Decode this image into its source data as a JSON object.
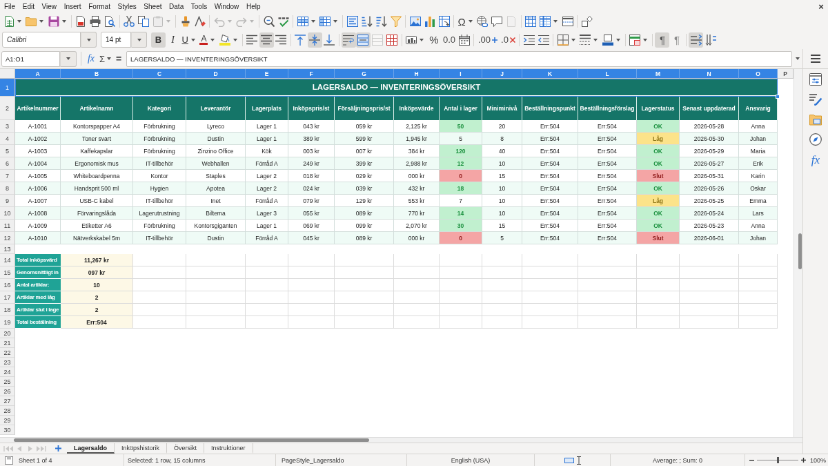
{
  "menu_bar": {
    "items": [
      "File",
      "Edit",
      "View",
      "Insert",
      "Format",
      "Styles",
      "Sheet",
      "Data",
      "Tools",
      "Window",
      "Help"
    ],
    "close": "×"
  },
  "standard_toolbar": {
    "buttons": [
      {
        "disabled": false
      },
      {
        "disabled": false
      },
      {
        "disabled": false
      },
      {
        "disabled": false
      },
      {
        "disabled": false
      },
      {
        "disabled": false
      },
      {
        "disabled": false
      },
      {
        "disabled": false
      },
      {
        "disabled": true
      },
      {
        "disabled": false
      },
      {
        "disabled": false
      },
      {
        "disabled": true
      },
      {
        "disabled": true
      },
      {
        "disabled": false
      },
      {
        "disabled": false
      },
      {
        "disabled": false
      },
      {
        "disabled": false
      },
      {
        "disabled": false
      },
      {
        "disabled": false
      },
      {
        "disabled": false
      },
      {
        "disabled": false
      },
      {
        "disabled": false
      },
      {
        "disabled": false
      },
      {
        "disabled": false
      },
      {
        "label": "Ω",
        "disabled": false
      },
      {
        "disabled": false
      },
      {
        "disabled": false
      },
      {
        "disabled": true
      },
      {
        "disabled": false
      },
      {
        "disabled": false
      },
      {
        "disabled": false
      },
      {
        "disabled": false
      }
    ]
  },
  "formatting_toolbar": {
    "font_name": "Calibri",
    "font_size": "14 pt",
    "buttons": [
      {
        "label": "B",
        "on": true,
        "disabled": false
      },
      {
        "label": "I",
        "on": false,
        "disabled": false
      },
      {
        "label": "U",
        "on": false,
        "disabled": false
      },
      {
        "label": "A",
        "on": false,
        "disabled": false
      },
      {
        "on": false,
        "disabled": false
      },
      {
        "on": false,
        "disabled": false
      },
      {
        "on": true,
        "disabled": false
      },
      {
        "on": false,
        "disabled": false
      },
      {
        "on": false,
        "disabled": false
      },
      {
        "on": true,
        "disabled": false
      },
      {
        "on": false,
        "disabled": false
      },
      {
        "on": true,
        "disabled": false
      },
      {
        "on": true,
        "disabled": false
      },
      {
        "on": false,
        "disabled": true
      },
      {
        "on": false,
        "disabled": false
      },
      {
        "on": false,
        "disabled": false
      },
      {
        "label": "%",
        "on": false,
        "disabled": false
      },
      {
        "label": "0.0",
        "on": false,
        "disabled": false
      },
      {
        "on": false,
        "disabled": false
      },
      {
        "label": ".00",
        "on": false,
        "disabled": false
      },
      {
        "label": ".0",
        "on": false,
        "disabled": false
      },
      {
        "on": false,
        "disabled": false
      },
      {
        "on": false,
        "disabled": false
      },
      {
        "on": false,
        "disabled": false
      },
      {
        "on": false,
        "disabled": false
      },
      {
        "on": false,
        "disabled": false
      },
      {
        "on": false,
        "disabled": false
      },
      {
        "label": "¶",
        "on": true,
        "disabled": false
      },
      {
        "label": "¶",
        "on": false,
        "disabled": false
      },
      {
        "on": true,
        "disabled": false
      },
      {
        "on": false,
        "disabled": false
      }
    ]
  },
  "formula_bar": {
    "name_box": "A1:O1",
    "function_wizard": "fx",
    "sum": "Σ",
    "equals": "=",
    "content": "LAGERSALDO — INVENTERINGSÖVERSIKT"
  },
  "sheet": {
    "columns": [
      {
        "label": "A",
        "selected": true
      },
      {
        "label": "B",
        "selected": true
      },
      {
        "label": "C",
        "selected": true
      },
      {
        "label": "D",
        "selected": true
      },
      {
        "label": "E",
        "selected": true
      },
      {
        "label": "F",
        "selected": true
      },
      {
        "label": "G",
        "selected": true
      },
      {
        "label": "H",
        "selected": true
      },
      {
        "label": "I",
        "selected": true
      },
      {
        "label": "J",
        "selected": true
      },
      {
        "label": "K",
        "selected": true
      },
      {
        "label": "L",
        "selected": true
      },
      {
        "label": "M",
        "selected": true
      },
      {
        "label": "N",
        "selected": true
      },
      {
        "label": "O",
        "selected": true
      },
      {
        "label": "P",
        "selected": false
      }
    ],
    "rows": [
      {
        "kind": "title",
        "number": "1",
        "selected": true,
        "text": "LAGERSALDO — INVENTERINGSÖVERSIKT"
      },
      {
        "kind": "header",
        "number": "2",
        "selected": false,
        "cells": [
          "Artikelnummer",
          "Artikelnamn",
          "Kategori",
          "Leverantör",
          "Lagerplats",
          "Inköpspris/st",
          "Försäljningspris/st",
          "Inköpsvärde",
          "Antal i lager",
          "Miniminivå",
          "Beställningspunkt",
          "Beställningsförslag",
          "Lagerstatus",
          "Senast uppdaterad",
          "Ansvarig"
        ]
      },
      {
        "kind": "data",
        "number": "3",
        "selected": false,
        "cells": [
          "A-1001",
          "Kontorspapper A4",
          "Förbrukning",
          "Lyreco",
          "Lager 1",
          "043 kr",
          "059 kr",
          "2,125 kr",
          {
            "text": "50",
            "color": "#c1f0cf"
          },
          "20",
          "Err:504",
          "Err:504",
          {
            "text": "OK",
            "color": "#c1f0cf"
          },
          "2026-05-28",
          "Anna"
        ]
      },
      {
        "kind": "data",
        "number": "4",
        "selected": false,
        "cells": [
          "A-1002",
          "Toner svart",
          "Förbrukning",
          "Dustin",
          "Lager 1",
          "389 kr",
          "599 kr",
          "1,945 kr",
          "5",
          "8",
          "Err:504",
          "Err:504",
          {
            "text": "Låg",
            "color": "#fce38a"
          },
          "2026-05-30",
          "Johan"
        ]
      },
      {
        "kind": "data",
        "number": "5",
        "selected": false,
        "cells": [
          "A-1003",
          "Kaffekapslar",
          "Förbrukning",
          "Zinzino Office",
          "Kök",
          "003 kr",
          "007 kr",
          "384 kr",
          {
            "text": "120",
            "color": "#c1f0cf"
          },
          "40",
          "Err:504",
          "Err:504",
          {
            "text": "OK",
            "color": "#c1f0cf"
          },
          "2026-05-29",
          "Maria"
        ]
      },
      {
        "kind": "data",
        "number": "6",
        "selected": false,
        "cells": [
          "A-1004",
          "Ergonomisk mus",
          "IT-tillbehör",
          "Webhallen",
          "Förråd A",
          "249 kr",
          "399 kr",
          "2,988 kr",
          {
            "text": "12",
            "color": "#c1f0cf"
          },
          "10",
          "Err:504",
          "Err:504",
          {
            "text": "OK",
            "color": "#c1f0cf"
          },
          "2026-05-27",
          "Erik"
        ]
      },
      {
        "kind": "data",
        "number": "7",
        "selected": false,
        "cells": [
          "A-1005",
          "Whiteboardpenna",
          "Kontor",
          "Staples",
          "Lager 2",
          "018 kr",
          "029 kr",
          "000 kr",
          {
            "text": "0",
            "color": "#f4a5a5"
          },
          "15",
          "Err:504",
          "Err:504",
          {
            "text": "Slut",
            "color": "#f4a5a5"
          },
          "2026-05-31",
          "Karin"
        ]
      },
      {
        "kind": "data",
        "number": "8",
        "selected": false,
        "cells": [
          "A-1006",
          "Handsprit 500 ml",
          "Hygien",
          "Apotea",
          "Lager 2",
          "024 kr",
          "039 kr",
          "432 kr",
          {
            "text": "18",
            "color": "#c1f0cf"
          },
          "10",
          "Err:504",
          "Err:504",
          {
            "text": "OK",
            "color": "#c1f0cf"
          },
          "2026-05-26",
          "Oskar"
        ]
      },
      {
        "kind": "data",
        "number": "9",
        "selected": false,
        "cells": [
          "A-1007",
          "USB-C kabel",
          "IT-tillbehör",
          "Inet",
          "Förråd A",
          "079 kr",
          "129 kr",
          "553 kr",
          "7",
          "10",
          "Err:504",
          "Err:504",
          {
            "text": "Låg",
            "color": "#fce38a"
          },
          "2026-05-25",
          "Emma"
        ]
      },
      {
        "kind": "data",
        "number": "10",
        "selected": false,
        "cells": [
          "A-1008",
          "Förvaringslåda",
          "Lagerutrustning",
          "Biltema",
          "Lager 3",
          "055 kr",
          "089 kr",
          "770 kr",
          {
            "text": "14",
            "color": "#c1f0cf"
          },
          "10",
          "Err:504",
          "Err:504",
          {
            "text": "OK",
            "color": "#c1f0cf"
          },
          "2026-05-24",
          "Lars"
        ]
      },
      {
        "kind": "data",
        "number": "11",
        "selected": false,
        "cells": [
          "A-1009",
          "Etiketter A6",
          "Förbrukning",
          "Kontorsgiganten",
          "Lager 1",
          "069 kr",
          "099 kr",
          "2,070 kr",
          {
            "text": "30",
            "color": "#c1f0cf"
          },
          "15",
          "Err:504",
          "Err:504",
          {
            "text": "OK",
            "color": "#c1f0cf"
          },
          "2026-05-23",
          "Anna"
        ]
      },
      {
        "kind": "data",
        "number": "12",
        "selected": false,
        "cells": [
          "A-1010",
          "Nätverkskabel 5m",
          "IT-tillbehör",
          "Dustin",
          "Förråd A",
          "045 kr",
          "089 kr",
          "000 kr",
          {
            "text": "0",
            "color": "#f4a5a5"
          },
          "5",
          "Err:504",
          "Err:504",
          {
            "text": "Slut",
            "color": "#f4a5a5"
          },
          "2026-06-01",
          "Johan"
        ]
      },
      {
        "kind": "blank",
        "number": "13",
        "selected": false
      },
      {
        "kind": "summary",
        "number": "14",
        "selected": false,
        "label": "Total inköpsvärd",
        "value": "11,267 kr"
      },
      {
        "kind": "summary",
        "number": "15",
        "selected": false,
        "label": "Genomsnittligt in",
        "value": "097 kr"
      },
      {
        "kind": "summary",
        "number": "16",
        "selected": false,
        "label": "Antal artiklar:",
        "value": "10"
      },
      {
        "kind": "summary",
        "number": "17",
        "selected": false,
        "label": "Artiklar med låg",
        "value": "2"
      },
      {
        "kind": "summary",
        "number": "18",
        "selected": false,
        "label": "Artiklar slut i lage",
        "value": "2"
      },
      {
        "kind": "summary",
        "number": "19",
        "selected": false,
        "label": "Total beställning",
        "value": "Err:504"
      },
      {
        "kind": "blank",
        "number": "20",
        "selected": false
      },
      {
        "kind": "blank",
        "number": "21",
        "selected": false
      },
      {
        "kind": "blank",
        "number": "22",
        "selected": false
      },
      {
        "kind": "blank",
        "number": "23",
        "selected": false
      },
      {
        "kind": "blank",
        "number": "24",
        "selected": false
      },
      {
        "kind": "blank",
        "number": "25",
        "selected": false
      },
      {
        "kind": "blank",
        "number": "26",
        "selected": false
      },
      {
        "kind": "blank",
        "number": "27",
        "selected": false
      },
      {
        "kind": "blank",
        "number": "28",
        "selected": false
      },
      {
        "kind": "blank",
        "number": "29",
        "selected": false
      },
      {
        "kind": "blank",
        "number": "30",
        "selected": false
      }
    ]
  },
  "sidebar": {
    "functions": "fx"
  },
  "sheet_tabs": {
    "navigation": [
      {
        "disabled": true
      },
      {
        "disabled": true
      },
      {
        "disabled": true
      },
      {
        "disabled": true
      }
    ],
    "tabs": [
      {
        "label": "Lagersaldo",
        "selected": true
      },
      {
        "label": "Inköpshistorik",
        "selected": false
      },
      {
        "label": "Översikt",
        "selected": false
      },
      {
        "label": "Instruktioner",
        "selected": false
      }
    ]
  },
  "status_bar": {
    "sheet": "Sheet 1 of 4",
    "selection": "Selected: 1 row, 15 columns",
    "page_style": "PageStyle_Lagersaldo",
    "language": "English (USA)",
    "summary": "Average: ; Sum: 0",
    "zoom": {
      "level": 0.5,
      "reading": "100%"
    }
  }
}
